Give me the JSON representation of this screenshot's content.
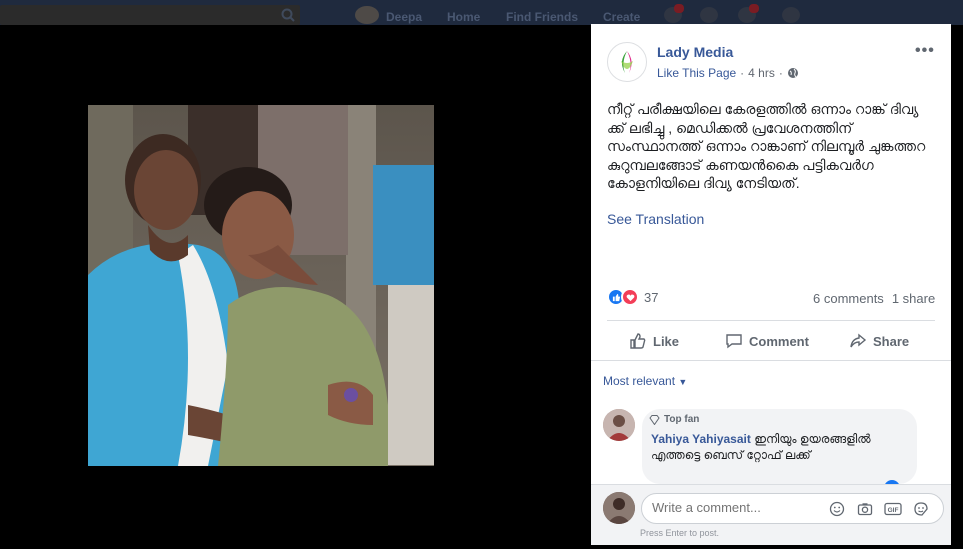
{
  "topbar": {
    "user_name": "Deepa",
    "nav": [
      "Home",
      "Find Friends",
      "Create"
    ]
  },
  "post": {
    "page_name": "Lady Media",
    "like_page": "Like This Page",
    "separator": "·",
    "time": "4 hrs",
    "more": "•••",
    "text": "നീറ്റ് പരീക്ഷയിലെ കേരളത്തിൽ ഒന്നാം റാങ്ക് ദിവ്യ ക്ക് ലഭിച്ചു , മെഡിക്കൽ പ്രവേശനത്തിന് സംസ്ഥാനത്ത് ഒന്നാം റാങ്കാണ് നിലമ്പൂർ ചുങ്കത്തറ കുറുമ്പലങ്ങോട് കണയൻകൈ പട്ടികവർഗ കോളനിയിലെ ദിവ്യ നേടിയത്.",
    "see_translation": "See Translation",
    "reaction_count": "37",
    "comments_count": "6 comments",
    "shares_count": "1 share",
    "actions": {
      "like": "Like",
      "comment": "Comment",
      "share": "Share"
    }
  },
  "comments": {
    "filter": "Most relevant",
    "items": [
      {
        "badge": "Top fan",
        "author": "Yahiya Yahiyasait",
        "text": "ഇനിയും ഉയരങ്ങളിൽ എത്തട്ടെ ബെസ് റ്റോഫ് ലക്ക്"
      }
    ],
    "composer_placeholder": "Write a comment...",
    "press_enter": "Press Enter to post."
  },
  "colors": {
    "link": "#385898",
    "like_blue": "#1877f2",
    "love_red": "#f33e58"
  }
}
